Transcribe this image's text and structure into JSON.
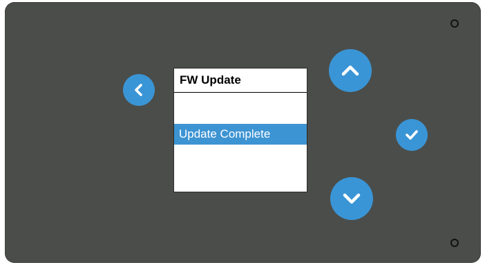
{
  "screen": {
    "title": "FW Update",
    "items": [
      {
        "label": ""
      },
      {
        "label": "Update Complete",
        "selected": true
      }
    ]
  },
  "buttons": {
    "back_icon": "chevron-left-icon",
    "up_icon": "chevron-up-icon",
    "confirm_icon": "check-icon",
    "down_icon": "chevron-down-icon"
  },
  "colors": {
    "panel": "#4b4d4a",
    "accent": "#3a95d6",
    "selection": "#3d94d3",
    "screen_bg": "#ffffff"
  }
}
